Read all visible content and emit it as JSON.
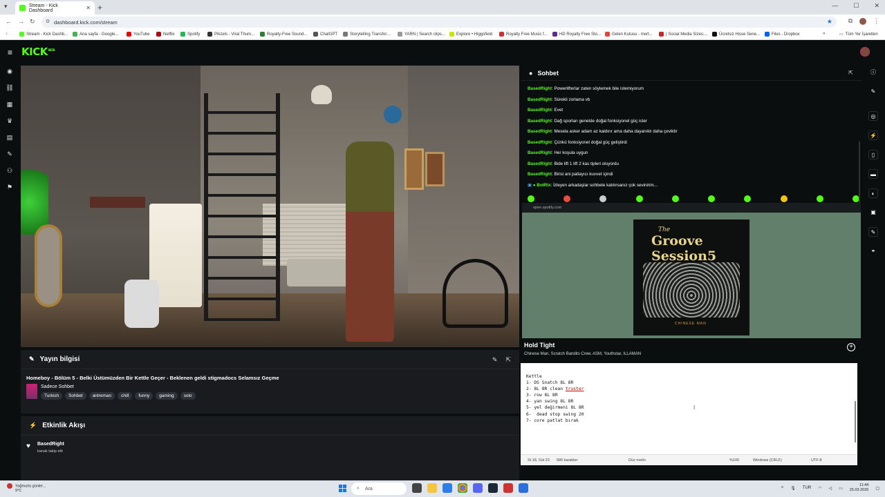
{
  "browser": {
    "tab_title": "Stream - Kick Dashboard",
    "url": "dashboard.kick.com/stream",
    "bookmarks": [
      "Stream - Kick Dashb...",
      "Ana sayfa - Google...",
      "YouTube",
      "Netflix",
      "Spotify",
      "Pikzels - Viral Thum...",
      "Royalty-Free Sound...",
      "ChatGPT",
      "Storytelling Transfor...",
      "YARN | Search clips...",
      "Explore • Higgsfield",
      "Royalty Free Music f...",
      "HD Royalty Free Sto...",
      "Gelen Kutusu - mert...",
      "| Social Media Sizes:...",
      "Ücretsiz Hisse Sene...",
      "Files - Dropbox"
    ],
    "bookmarks_all": "Tüm Yer İşaretleri"
  },
  "kick": {
    "logo": "KICK",
    "logo_badge": "BETA"
  },
  "stream_info": {
    "heading": "Yayın bilgisi",
    "title": "Homeboy - Bölüm 5 - Belki Üstümüzden Bir Kettle Geçer - Beklenen geldi stigmadocs Selamsız Geçme",
    "category": "Sadece Sohbet",
    "tags": [
      "Turkish",
      "Sohbet",
      "antreman",
      "chill",
      "funny",
      "gaming",
      "solo"
    ]
  },
  "activity": {
    "heading": "Etkinlik Akışı",
    "user": "BasedRight",
    "text": "kanalı takip etti"
  },
  "chat": {
    "heading": "Sohbet",
    "messages": [
      {
        "user": "BasedRight",
        "text": "Powerlifterlar zaten söylemek bile istemiyorum"
      },
      {
        "user": "BasedRight",
        "text": "Sürekli zorlama vb"
      },
      {
        "user": "BasedRight",
        "text": "Evet"
      },
      {
        "user": "BasedRight",
        "text": "Dağ sporları genelde doğal fonksiyonel güç ister"
      },
      {
        "user": "BasedRight",
        "text": "Mesela asker adam az kaldırır ama daha dayanıklı daha çeviktir"
      },
      {
        "user": "BasedRight",
        "text": "Çünkü fonksiyonel doğal güç geliştirdi"
      },
      {
        "user": "BasedRight",
        "text": "Her koşula uygun"
      },
      {
        "user": "BasedRight",
        "text": "Bide lift 1 lift 2 kas tipleri oluyordu"
      },
      {
        "user": "BasedRight",
        "text": "Birisi ani patlayıcı kuvvet içindi"
      },
      {
        "user": "BotRix",
        "text": "İzleyen arkadaşlar sohbete katılırsanız çok sevinirim..."
      }
    ]
  },
  "spotify": {
    "url": "open.spotify.com",
    "album_line1": "The",
    "album_line2": "Groove Session5",
    "album_label": "CHINESE MAN",
    "track": "Hold Tight",
    "artists": "Chinese Man, Scratch Bandits Crew, ASM, Youthstar, ILLAMAN"
  },
  "notepad": {
    "lines": [
      "Kettle",
      "1- DS Snatch 8L 8R",
      "2- 8L 8R clean ",
      "3- row 8L 8R",
      "4- yan swing 8L 8R",
      "5- yel değirmeni 8L 8R",
      "6-  dead stop swing 20",
      "7- core patlat bırak"
    ],
    "misspelled": "truster",
    "status_pos": "St 18, Süt 23",
    "status_chars": "586 karakter",
    "status_format": "Düz metin",
    "status_zoom": "%100",
    "status_eol": "Windows (CRLF)",
    "status_enc": "UTF-8"
  },
  "taskbar": {
    "weather_title": "Yağmurlu günler...",
    "weather_temp": "9°C",
    "search": "Ara",
    "lang": "TUR",
    "time": "11:44",
    "date": "25.03.2026"
  },
  "colors": {
    "kick_green": "#53fc18",
    "background": "#0b0e0f",
    "panel": "#191b1f"
  }
}
